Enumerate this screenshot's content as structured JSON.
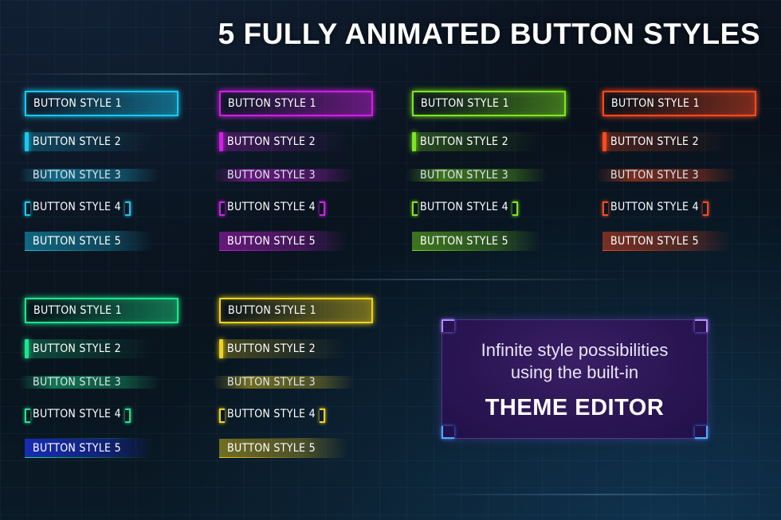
{
  "headline": "5 FULLY ANIMATED BUTTON STYLES",
  "button_labels": {
    "style1": "BUTTON STYLE 1",
    "style2": "BUTTON STYLE 2",
    "style3": "BUTTON STYLE 3",
    "style4": "BUTTON STYLE 4",
    "style5": "BUTTON STYLE 5"
  },
  "color_themes": [
    {
      "name": "cyan",
      "accent": "#19c8f0"
    },
    {
      "name": "magenta",
      "accent": "#d21ee6"
    },
    {
      "name": "green",
      "accent": "#7ee61e"
    },
    {
      "name": "orange-red",
      "accent": "#ff4a1e"
    },
    {
      "name": "teal-green",
      "accent": "#1ee68c"
    },
    {
      "name": "yellow",
      "accent": "#f0d21e"
    }
  ],
  "style5_fill_overrides": {
    "teal-green": "#1a2fd0"
  },
  "promo": {
    "line1": "Infinite style possibilities",
    "line2": "using the built-in",
    "emphasis": "THEME EDITOR",
    "border_colors": [
      "#b58cff",
      "#58a8ff"
    ],
    "background": "#2a1552"
  }
}
